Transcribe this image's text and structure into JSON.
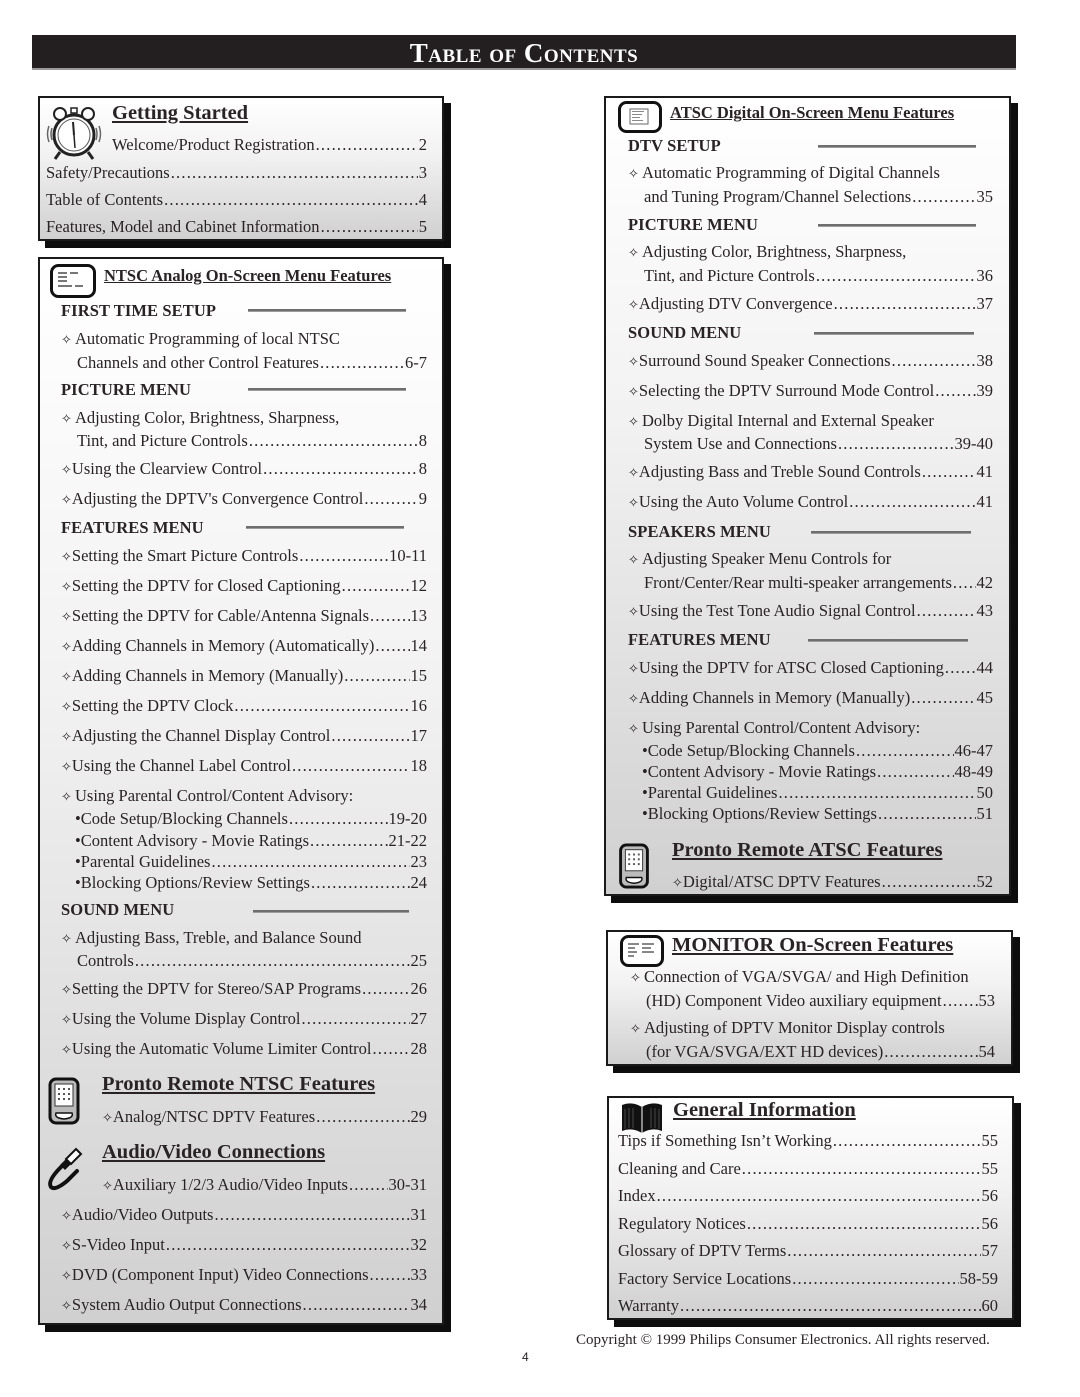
{
  "page_title": "Table of Contents",
  "getting_started": {
    "title": "Getting Started",
    "icon": "alarm-clock-icon",
    "items": [
      {
        "label": "Welcome/Product Registration",
        "page": "2"
      },
      {
        "label": "Safety/Precautions",
        "page": "3"
      },
      {
        "label": "Table of Contents",
        "page": "4"
      },
      {
        "label": "Features, Model and Cabinet Information",
        "page": "5"
      }
    ]
  },
  "ntsc": {
    "title": "NTSC Analog On-Screen Menu Features",
    "icon": "tv-screen-icon",
    "first_time_setup": {
      "heading": "FIRST TIME SETUP",
      "items": [
        {
          "label_line1": "Automatic Programming of local NTSC",
          "label_line2": "Channels and other Control Features",
          "page": "6-7"
        }
      ]
    },
    "picture_menu": {
      "heading": "PICTURE MENU",
      "items": [
        {
          "label_line1": "Adjusting Color, Brightness, Sharpness,",
          "label_line2": "Tint, and Picture Controls",
          "page": "8"
        },
        {
          "label": "Using the Clearview Control",
          "page": "8"
        },
        {
          "label": "Adjusting the DPTV's Convergence Control",
          "page": "9"
        }
      ]
    },
    "features_menu": {
      "heading": "FEATURES MENU",
      "items": [
        {
          "label": "Setting the Smart Picture Controls",
          "page": "10-11"
        },
        {
          "label": "Setting the DPTV for Closed Captioning",
          "page": "12"
        },
        {
          "label": "Setting the DPTV for Cable/Antenna Signals",
          "page": "13"
        },
        {
          "label": "Adding Channels in Memory (Automatically)",
          "page": "14"
        },
        {
          "label": "Adding Channels in Memory (Manually)",
          "page": "15"
        },
        {
          "label": "Setting the DPTV Clock",
          "page": "16"
        },
        {
          "label": "Adjusting the Channel Display Control",
          "page": "17"
        },
        {
          "label": "Using the Channel Label Control",
          "page": "18"
        }
      ],
      "parental": {
        "label": "Using Parental Control/Content Advisory:",
        "subitems": [
          {
            "label": "Code Setup/Blocking Channels",
            "page": "19-20"
          },
          {
            "label": "Content Advisory - Movie Ratings",
            "page": "21-22"
          },
          {
            "label": "Parental Guidelines",
            "page": "23"
          },
          {
            "label": "Blocking Options/Review Settings",
            "page": "24"
          }
        ]
      }
    },
    "sound_menu": {
      "heading": "SOUND MENU",
      "items": [
        {
          "label_line1": "Adjusting Bass, Treble, and Balance Sound",
          "label_line2": "Controls",
          "page": "25"
        },
        {
          "label": "Setting the DPTV for Stereo/SAP Programs",
          "page": "26"
        },
        {
          "label": "Using the Volume Display Control",
          "page": "27"
        },
        {
          "label": "Using the Automatic Volume Limiter Control",
          "page": "28"
        }
      ]
    },
    "pronto": {
      "title": "Pronto Remote NTSC Features",
      "icon": "remote-control-icon",
      "items": [
        {
          "label": "Analog/NTSC DPTV Features",
          "page": "29"
        }
      ]
    },
    "av_connections": {
      "title": "Audio/Video Connections",
      "icon": "av-cable-icon",
      "items": [
        {
          "label": "Auxiliary 1/2/3 Audio/Video Inputs",
          "page": "30-31"
        },
        {
          "label": "Audio/Video Outputs",
          "page": "31"
        },
        {
          "label": "S-Video Input",
          "page": "32"
        },
        {
          "label": "DVD (Component Input) Video Connections",
          "page": "33"
        },
        {
          "label": "System Audio Output Connections",
          "page": "34"
        }
      ]
    }
  },
  "atsc": {
    "title": "ATSC Digital On-Screen Menu Features",
    "icon": "tv-screen-icon",
    "dtv_setup": {
      "heading": "DTV SETUP",
      "items": [
        {
          "label_line1": "Automatic Programming of Digital Channels",
          "label_line2": "and Tuning Program/Channel Selections",
          "page": "35"
        }
      ]
    },
    "picture_menu": {
      "heading": "PICTURE MENU",
      "items": [
        {
          "label_line1": "Adjusting Color, Brightness, Sharpness,",
          "label_line2": "Tint, and Picture Controls",
          "page": "36"
        },
        {
          "label": "Adjusting DTV Convergence",
          "page": "37"
        }
      ]
    },
    "sound_menu": {
      "heading": "SOUND MENU",
      "items": [
        {
          "label": "Surround Sound Speaker Connections",
          "page": "38"
        },
        {
          "label": "Selecting the DPTV Surround Mode Control",
          "page": "39"
        },
        {
          "label_line1": "Dolby Digital Internal and External Speaker",
          "label_line2": "System Use and Connections",
          "page": "39-40"
        },
        {
          "label": "Adjusting Bass and Treble Sound Controls",
          "page": "41"
        },
        {
          "label": "Using the Auto Volume Control",
          "page": "41"
        }
      ]
    },
    "speakers_menu": {
      "heading": "SPEAKERS MENU",
      "items": [
        {
          "label_line1": "Adjusting Speaker Menu Controls for",
          "label_line2": "Front/Center/Rear multi-speaker arrangements",
          "page": "42"
        },
        {
          "label": "Using the Test Tone Audio Signal Control",
          "page": "43"
        }
      ]
    },
    "features_menu": {
      "heading": "FEATURES MENU",
      "items": [
        {
          "label": "Using the DPTV for ATSC Closed Captioning",
          "page": "44"
        },
        {
          "label": "Adding Channels in Memory (Manually)",
          "page": "45"
        }
      ],
      "parental": {
        "label": "Using Parental Control/Content Advisory:",
        "subitems": [
          {
            "label": "Code Setup/Blocking Channels",
            "page": "46-47"
          },
          {
            "label": "Content Advisory - Movie Ratings",
            "page": "48-49"
          },
          {
            "label": "Parental Guidelines",
            "page": "50"
          },
          {
            "label": "Blocking Options/Review Settings",
            "page": "51"
          }
        ]
      }
    },
    "pronto": {
      "title": "Pronto Remote ATSC Features",
      "icon": "remote-control-icon",
      "items": [
        {
          "label": "Digital/ATSC DPTV Features",
          "page": "52"
        }
      ]
    }
  },
  "monitor": {
    "title": "MONITOR On-Screen Features",
    "icon": "monitor-screen-icon",
    "items": [
      {
        "label_line1": "Connection of VGA/SVGA/ and High Definition",
        "label_line2": "(HD) Component Video auxiliary equipment",
        "page": "53"
      },
      {
        "label_line1": "Adjusting of DPTV Monitor Display controls",
        "label_line2": "(for VGA/SVGA/EXT HD devices)",
        "page": "54"
      }
    ]
  },
  "general": {
    "title": "General Information",
    "icon": "open-book-icon",
    "items": [
      {
        "label": "Tips if Something Isn’t Working",
        "page": "55"
      },
      {
        "label": "Cleaning and Care",
        "page": "55"
      },
      {
        "label": "Index",
        "page": "56"
      },
      {
        "label": "Regulatory Notices",
        "page": "56"
      },
      {
        "label": "Glossary of DPTV Terms",
        "page": "57"
      },
      {
        "label": "Factory Service Locations",
        "page": "58-59"
      },
      {
        "label": "Warranty",
        "page": "60"
      }
    ]
  },
  "footer": {
    "copyright": "Copyright © 1999 Philips Consumer Electronics. All rights reserved.",
    "page_number": "4"
  },
  "glyphs": {
    "diamond": "✧",
    "bullet": "•"
  }
}
